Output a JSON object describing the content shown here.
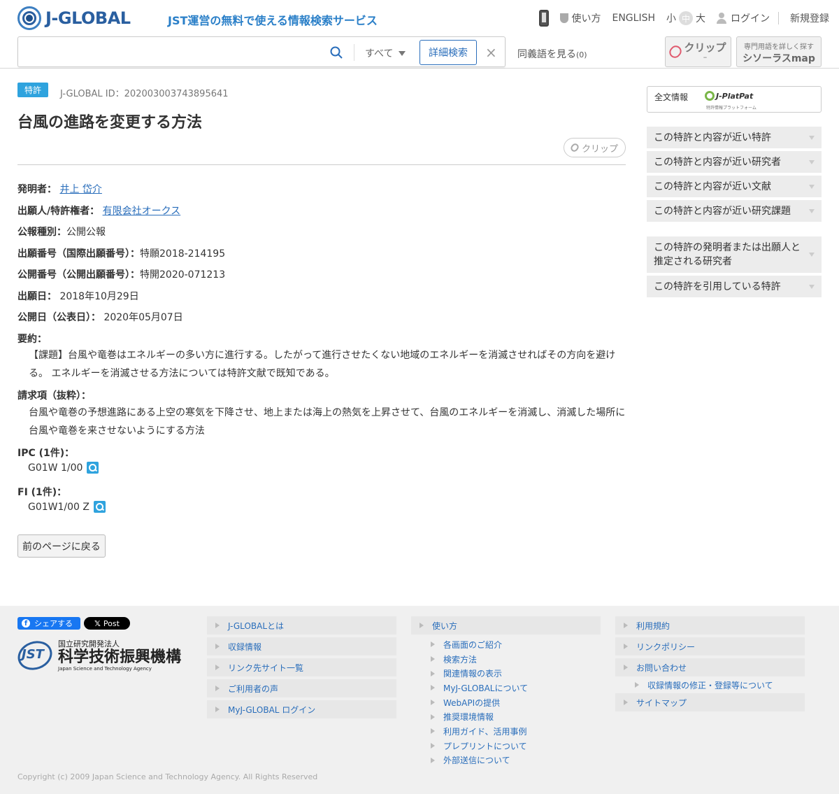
{
  "header": {
    "logo_text": "J-GLOBAL",
    "tagline": "JST運営の無料で使える情報検索サービス",
    "nav": {
      "usage": "使い方",
      "english": "ENGLISH",
      "size_small": "小",
      "size_mid": "中",
      "size_large": "大",
      "login": "ログイン",
      "register": "新規登録"
    },
    "search": {
      "value": "",
      "placeholder": "",
      "scope": "すべて",
      "advanced": "詳細検索",
      "clear": "×"
    },
    "synonym": "同義語を見る",
    "synonym_count": "(0)",
    "clip": {
      "label": "クリップ",
      "count": "–"
    },
    "thesaurus": {
      "line1": "専門用語を詳しく探す",
      "line2": "シソーラスmap"
    }
  },
  "record": {
    "badge": "特許",
    "id_label": "J-GLOBAL ID：202003003743895641",
    "title": "台風の進路を変更する方法",
    "clip_label": "クリップ",
    "fields": {
      "inventor_label": "発明者：",
      "inventor": "井上 岱介",
      "applicant_label": "出願人/特許権者：",
      "applicant": "有限会社オークス",
      "pubtype_label": "公報種別：",
      "pubtype": "公開公報",
      "appno_label": "出願番号（国際出願番号）：",
      "appno": "特願2018-214195",
      "pubno_label": "公開番号（公開出願番号）：",
      "pubno": "特開2020-071213",
      "appdate_label": "出願日：",
      "appdate": "2018年10月29日",
      "pubdate_label": "公開日（公表日）：",
      "pubdate": "2020年05月07日",
      "abstract_label": "要約：",
      "abstract": "【課題】台風や竜巻はエネルギーの多い方に進行する。したがって進行させたくない地域のエネルギーを消滅させればその方向を避ける。 エネルギーを消滅させる方法については特許文献で既知である。",
      "claims_label": "請求項（抜粋）：",
      "claims": "台風や竜巻の予想進路にある上空の寒気を下降させ、地上または海上の熱気を上昇させて、台風のエネルギーを消滅し、消滅した場所に台風や竜巻を来させないようにする方法",
      "ipc_label": "IPC (1件)：",
      "ipc": "G01W 1/00",
      "fi_label": "FI (1件)：",
      "fi": "G01W1/00 Z"
    },
    "back_button": "前のページに戻る"
  },
  "sidebar": {
    "fulltext_label": "全文情報",
    "jpp_name": "J-PlatPat",
    "jpp_sub": "特許情報プラットフォーム",
    "items": [
      "この特許と内容が近い特許",
      "この特許と内容が近い研究者",
      "この特許と内容が近い文献",
      "この特許と内容が近い研究課題",
      "この特許の発明者または出願人と推定される研究者",
      "この特許を引用している特許"
    ]
  },
  "footer": {
    "fb_share": "シェアする",
    "x_post": "Post",
    "jst_line1": "国立研究開発法人",
    "jst_line2": "科学技術振興機構",
    "jst_line3": "Japan Science and Technology Agency",
    "col1": [
      "J-GLOBALとは",
      "収録情報",
      "リンク先サイト一覧",
      "ご利用者の声",
      "MyJ-GLOBAL ログイン"
    ],
    "col2_head": "使い方",
    "col2_subs": [
      "各画面のご紹介",
      "検索方法",
      "関連情報の表示",
      "MyJ-GLOBALについて",
      "WebAPIの提供",
      "推奨環境情報",
      "利用ガイド、活用事例",
      "プレプリントについて",
      "外部送信について"
    ],
    "col3": {
      "terms": "利用規約",
      "link_policy": "リンクポリシー",
      "contact": "お問い合わせ",
      "contact_sub": "収録情報の修正・登録等について",
      "sitemap": "サイトマップ"
    },
    "copyright": "Copyright (c) 2009 Japan Science and Technology Agency. All Rights Reserved"
  },
  "colors": {
    "brand_blue": "#2a5fa0",
    "link_blue": "#2a6ebb",
    "badge_blue": "#2fa3de",
    "clip_red": "#e05a6e"
  }
}
